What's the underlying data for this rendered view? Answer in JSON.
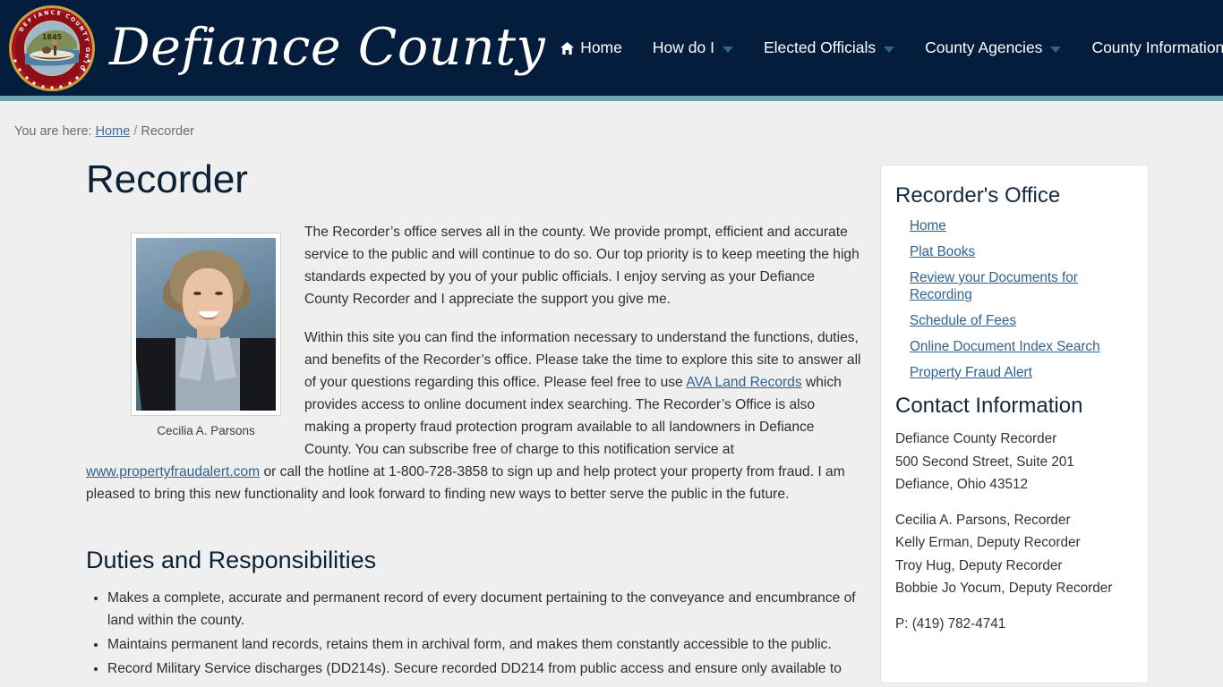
{
  "header": {
    "site_title": "Defiance County",
    "seal": {
      "outer_text": "DEFIANCE COUNTY, OHIO",
      "year": "1845"
    },
    "colors": {
      "header_bg": "#041d3c",
      "header_accent": "#6ba3b5",
      "link": "#2f6291",
      "heading": "#0d2135"
    },
    "nav": [
      {
        "label": "Home",
        "icon": "home-icon",
        "has_dropdown": false
      },
      {
        "label": "How do I",
        "icon": "chevron-down-icon",
        "has_dropdown": true
      },
      {
        "label": "Elected Officials",
        "icon": "chevron-down-icon",
        "has_dropdown": true
      },
      {
        "label": "County Agencies",
        "icon": "chevron-down-icon",
        "has_dropdown": true
      },
      {
        "label": "County Information",
        "icon": "chevron-down-icon",
        "has_dropdown": true
      }
    ]
  },
  "breadcrumb": {
    "prefix": "You are here:",
    "home": "Home",
    "separator": "/",
    "current": "Recorder"
  },
  "main": {
    "page_title": "Recorder",
    "portrait_caption": "Cecilia A. Parsons",
    "paragraph_1": "The Recorder’s office serves all in the county. We provide prompt, efficient and accurate service to the public and will continue to do so. Our top priority is to keep meeting the high standards expected by you of your public officials. I enjoy serving as your Defiance County Recorder and I appreciate the support you give me.",
    "paragraph_2_part_1": "Within this site you can find the information necessary to understand the functions, duties, and benefits of the Recorder’s office. Please take the time to explore this site to answer all of your questions regarding this office. Please feel free to use ",
    "paragraph_2_link_1": "AVA Land Records",
    "paragraph_2_part_2": " which provides access to online document index searching. The Recorder’s Office is also making a property fraud protection program available to all landowners in Defiance County. You can subscribe free of charge to this notification service at ",
    "paragraph_2_link_2": "www.propertyfraudalert.com",
    "paragraph_2_part_3": " or call the hotline at 1-800-728-3858 to sign up and help protect your property from fraud. I am pleased to bring this new functionality and look forward to finding new ways to better serve the public in the future.",
    "duties_heading": "Duties and Responsibilities",
    "duties": [
      "Makes a complete, accurate and permanent record of every document pertaining to the conveyance and encumbrance of land within the county.",
      "Maintains permanent land records, retains them in archival form, and makes them constantly accessible to the public.",
      "Record Military Service discharges (DD214s). Secure recorded DD214 from public access and ensure only available to"
    ]
  },
  "sidebar": {
    "title": "Recorder's Office",
    "links": [
      "Home",
      "Plat Books",
      "Review your Documents for Recording",
      "Schedule of Fees",
      "Online Document Index Search",
      "Property Fraud Alert"
    ],
    "contact_title": "Contact Information",
    "contact_address": [
      "Defiance County Recorder",
      "500 Second Street, Suite 201",
      "Defiance, Ohio 43512"
    ],
    "contact_staff": [
      "Cecilia A. Parsons, Recorder",
      "Kelly Erman, Deputy Recorder",
      "Troy Hug, Deputy Recorder",
      "Bobbie Jo Yocum, Deputy Recorder"
    ],
    "contact_phone": "P: (419) 782-4741"
  }
}
